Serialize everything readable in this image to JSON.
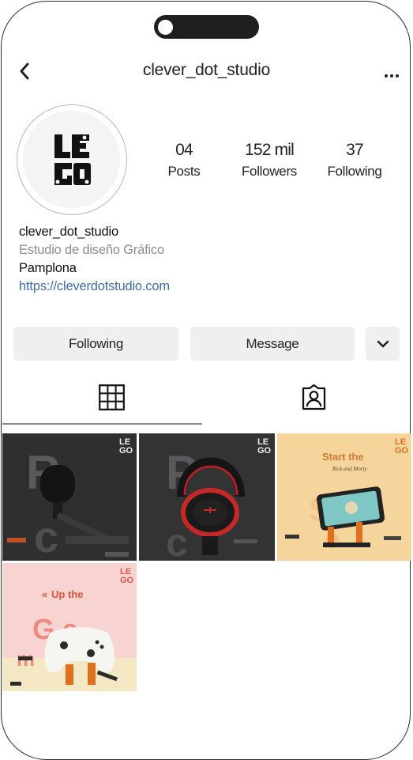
{
  "header": {
    "title": "clever_dot_studio"
  },
  "profile": {
    "stats": [
      {
        "value": "04",
        "label": "Posts"
      },
      {
        "value": "152 mil",
        "label": "Followers"
      },
      {
        "value": "37",
        "label": "Following"
      }
    ],
    "name": "clever_dot_studio",
    "description": "Estudio de diseño Gráfico",
    "location": "Pamplona",
    "link": "https://cleverdotstudio.com"
  },
  "actions": {
    "following_label": "Following",
    "message_label": "Message"
  },
  "tabs": {
    "active": "grid",
    "icons": [
      "grid-icon",
      "tagged-icon"
    ]
  },
  "posts": [
    {
      "icon": "microphone-post"
    },
    {
      "icon": "headphones-post"
    },
    {
      "icon": "phone-stand-post",
      "caption": "Start the"
    },
    {
      "icon": "controller-post",
      "caption": "Up the"
    }
  ],
  "colors": {
    "link": "#3f6ea8",
    "button_bg": "#efefef",
    "muted_text": "#8d8d8d"
  }
}
